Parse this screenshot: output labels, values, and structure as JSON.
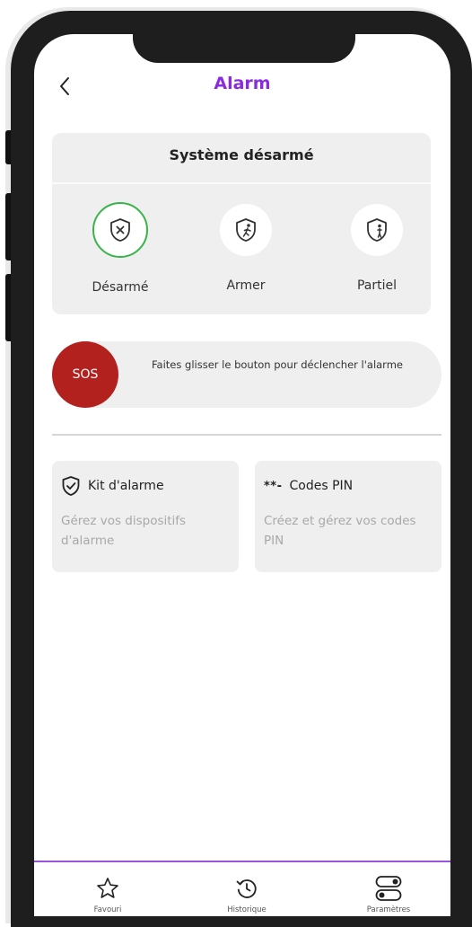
{
  "header": {
    "title": "Alarm",
    "back_icon": "chevron-left-icon"
  },
  "status": {
    "title": "Système désarmé",
    "modes": [
      {
        "label": "Désarmé",
        "icon": "shield-x-icon",
        "active": true
      },
      {
        "label": "Armer",
        "icon": "shield-running-person-icon",
        "active": false
      },
      {
        "label": "Partiel",
        "icon": "shield-person-icon",
        "active": false
      }
    ]
  },
  "sos": {
    "button_label": "SOS",
    "hint": "Faites glisser le bouton pour déclencher l'alarme"
  },
  "tiles": [
    {
      "icon": "shield-check-icon",
      "title": "Kit d'alarme",
      "description": "Gérez vos dispositifs d'alarme"
    },
    {
      "icon_text": "**-",
      "title": "Codes PIN",
      "description": "Créez et gérez vos codes PIN"
    }
  ],
  "tabbar": [
    {
      "label": "Favouri",
      "icon": "star-icon"
    },
    {
      "label": "Historique",
      "icon": "history-icon"
    },
    {
      "label": "Paramètres",
      "icon": "toggles-icon"
    }
  ],
  "colors": {
    "accent": "#8a2be2",
    "active_ring": "#3ab44a",
    "sos": "#b3211f",
    "card_bg": "#efefef"
  }
}
